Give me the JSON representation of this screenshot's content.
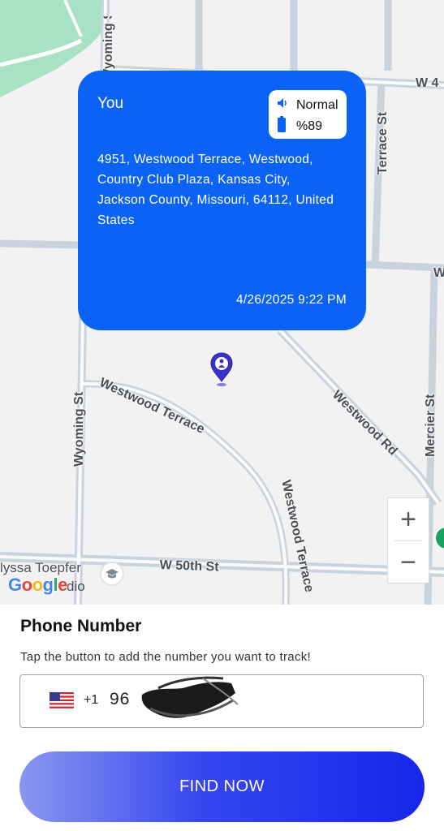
{
  "map": {
    "streets": {
      "wyoming_top": "Wyoming St",
      "wyoming": "Wyoming St",
      "westwood_terrace_arc": "Westwood Terrace",
      "westwood_terrace_vertical": "Westwood Terrace",
      "westwood_rd": "Westwood Rd",
      "terrace_st": "Terrace St",
      "mercier_st": "Mercier St",
      "w50th": "W 50th St",
      "w4_cut": "W 4",
      "w_cut": "W"
    },
    "poi_label_line1": "lyssa Toepfer",
    "poi_label_line2": "dio",
    "google_logo": "Google",
    "zoom_in_label": "+",
    "zoom_out_label": "−"
  },
  "card": {
    "name": "You",
    "sound_mode": "Normal",
    "battery": "%89",
    "address": "4951, Westwood Terrace, Westwood, Country Club Plaza, Kansas City, Jackson County, Missouri, 64112, United States",
    "timestamp": "4/26/2025 9:22 PM",
    "background_color": "#0b63f6"
  },
  "panel": {
    "title": "Phone Number",
    "hint": "Tap the button to add the number you want to track!",
    "country_flag": "us-flag-icon",
    "dial_code": "+1",
    "phone_value": "96",
    "button_label": "FIND NOW"
  }
}
